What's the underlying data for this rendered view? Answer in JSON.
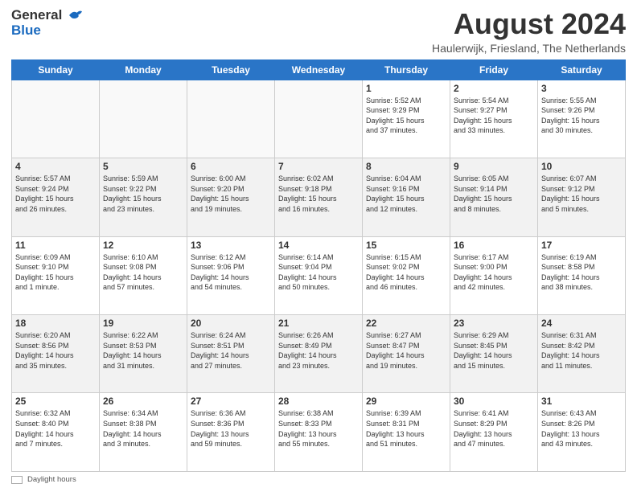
{
  "header": {
    "logo_line1": "General",
    "logo_line2": "Blue",
    "month_year": "August 2024",
    "location": "Haulerwijk, Friesland, The Netherlands"
  },
  "days_of_week": [
    "Sunday",
    "Monday",
    "Tuesday",
    "Wednesday",
    "Thursday",
    "Friday",
    "Saturday"
  ],
  "footer": {
    "daylight_label": "Daylight hours"
  },
  "weeks": [
    [
      {
        "day": "",
        "info": ""
      },
      {
        "day": "",
        "info": ""
      },
      {
        "day": "",
        "info": ""
      },
      {
        "day": "",
        "info": ""
      },
      {
        "day": "1",
        "info": "Sunrise: 5:52 AM\nSunset: 9:29 PM\nDaylight: 15 hours\nand 37 minutes."
      },
      {
        "day": "2",
        "info": "Sunrise: 5:54 AM\nSunset: 9:27 PM\nDaylight: 15 hours\nand 33 minutes."
      },
      {
        "day": "3",
        "info": "Sunrise: 5:55 AM\nSunset: 9:26 PM\nDaylight: 15 hours\nand 30 minutes."
      }
    ],
    [
      {
        "day": "4",
        "info": "Sunrise: 5:57 AM\nSunset: 9:24 PM\nDaylight: 15 hours\nand 26 minutes."
      },
      {
        "day": "5",
        "info": "Sunrise: 5:59 AM\nSunset: 9:22 PM\nDaylight: 15 hours\nand 23 minutes."
      },
      {
        "day": "6",
        "info": "Sunrise: 6:00 AM\nSunset: 9:20 PM\nDaylight: 15 hours\nand 19 minutes."
      },
      {
        "day": "7",
        "info": "Sunrise: 6:02 AM\nSunset: 9:18 PM\nDaylight: 15 hours\nand 16 minutes."
      },
      {
        "day": "8",
        "info": "Sunrise: 6:04 AM\nSunset: 9:16 PM\nDaylight: 15 hours\nand 12 minutes."
      },
      {
        "day": "9",
        "info": "Sunrise: 6:05 AM\nSunset: 9:14 PM\nDaylight: 15 hours\nand 8 minutes."
      },
      {
        "day": "10",
        "info": "Sunrise: 6:07 AM\nSunset: 9:12 PM\nDaylight: 15 hours\nand 5 minutes."
      }
    ],
    [
      {
        "day": "11",
        "info": "Sunrise: 6:09 AM\nSunset: 9:10 PM\nDaylight: 15 hours\nand 1 minute."
      },
      {
        "day": "12",
        "info": "Sunrise: 6:10 AM\nSunset: 9:08 PM\nDaylight: 14 hours\nand 57 minutes."
      },
      {
        "day": "13",
        "info": "Sunrise: 6:12 AM\nSunset: 9:06 PM\nDaylight: 14 hours\nand 54 minutes."
      },
      {
        "day": "14",
        "info": "Sunrise: 6:14 AM\nSunset: 9:04 PM\nDaylight: 14 hours\nand 50 minutes."
      },
      {
        "day": "15",
        "info": "Sunrise: 6:15 AM\nSunset: 9:02 PM\nDaylight: 14 hours\nand 46 minutes."
      },
      {
        "day": "16",
        "info": "Sunrise: 6:17 AM\nSunset: 9:00 PM\nDaylight: 14 hours\nand 42 minutes."
      },
      {
        "day": "17",
        "info": "Sunrise: 6:19 AM\nSunset: 8:58 PM\nDaylight: 14 hours\nand 38 minutes."
      }
    ],
    [
      {
        "day": "18",
        "info": "Sunrise: 6:20 AM\nSunset: 8:56 PM\nDaylight: 14 hours\nand 35 minutes."
      },
      {
        "day": "19",
        "info": "Sunrise: 6:22 AM\nSunset: 8:53 PM\nDaylight: 14 hours\nand 31 minutes."
      },
      {
        "day": "20",
        "info": "Sunrise: 6:24 AM\nSunset: 8:51 PM\nDaylight: 14 hours\nand 27 minutes."
      },
      {
        "day": "21",
        "info": "Sunrise: 6:26 AM\nSunset: 8:49 PM\nDaylight: 14 hours\nand 23 minutes."
      },
      {
        "day": "22",
        "info": "Sunrise: 6:27 AM\nSunset: 8:47 PM\nDaylight: 14 hours\nand 19 minutes."
      },
      {
        "day": "23",
        "info": "Sunrise: 6:29 AM\nSunset: 8:45 PM\nDaylight: 14 hours\nand 15 minutes."
      },
      {
        "day": "24",
        "info": "Sunrise: 6:31 AM\nSunset: 8:42 PM\nDaylight: 14 hours\nand 11 minutes."
      }
    ],
    [
      {
        "day": "25",
        "info": "Sunrise: 6:32 AM\nSunset: 8:40 PM\nDaylight: 14 hours\nand 7 minutes."
      },
      {
        "day": "26",
        "info": "Sunrise: 6:34 AM\nSunset: 8:38 PM\nDaylight: 14 hours\nand 3 minutes."
      },
      {
        "day": "27",
        "info": "Sunrise: 6:36 AM\nSunset: 8:36 PM\nDaylight: 13 hours\nand 59 minutes."
      },
      {
        "day": "28",
        "info": "Sunrise: 6:38 AM\nSunset: 8:33 PM\nDaylight: 13 hours\nand 55 minutes."
      },
      {
        "day": "29",
        "info": "Sunrise: 6:39 AM\nSunset: 8:31 PM\nDaylight: 13 hours\nand 51 minutes."
      },
      {
        "day": "30",
        "info": "Sunrise: 6:41 AM\nSunset: 8:29 PM\nDaylight: 13 hours\nand 47 minutes."
      },
      {
        "day": "31",
        "info": "Sunrise: 6:43 AM\nSunset: 8:26 PM\nDaylight: 13 hours\nand 43 minutes."
      }
    ]
  ]
}
